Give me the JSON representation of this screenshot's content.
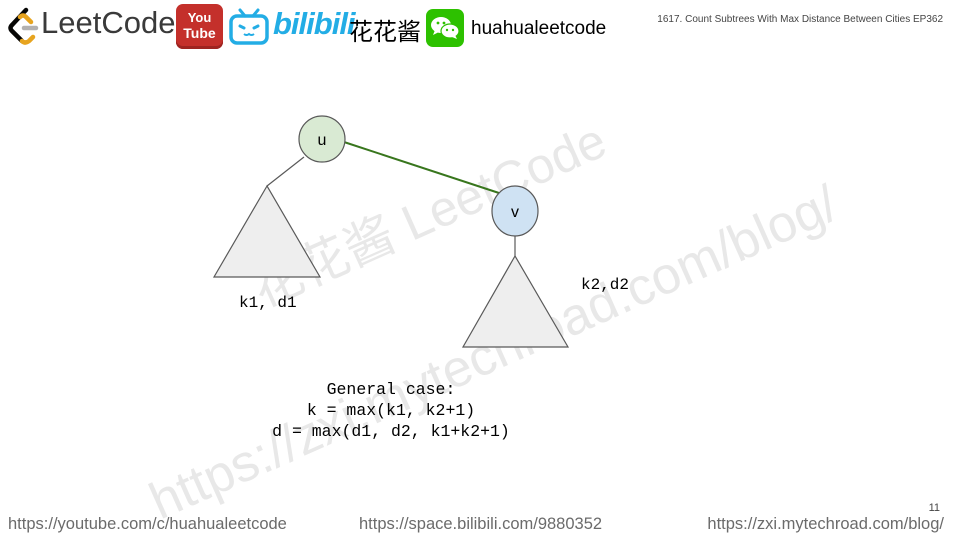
{
  "header": {
    "logo_text": "LeetCode",
    "youtube_text_1": "You",
    "youtube_text_2": "Tube",
    "bilibili_text": "bilibili",
    "channel_cn": "花花酱",
    "wechat_id": "huahualeetcode",
    "episode_title": "1617. Count Subtrees With Max Distance Between Cities EP362"
  },
  "watermark": {
    "line1": "花花酱 LeetCode",
    "line2": "https://zxi.mytechroad.com/blog/"
  },
  "diagram": {
    "node_u": "u",
    "node_v": "v",
    "label_left": "k1, d1",
    "label_right": "k2,d2",
    "colors": {
      "node_u_fill": "#d9ead3",
      "node_v_fill": "#cfe2f3",
      "edge_uv": "#38761d",
      "triangle_fill": "#eeeeee",
      "stroke": "#595959"
    }
  },
  "formula": {
    "line1": "General case:",
    "line2": "k = max(k1, k2+1)",
    "line3": "d = max(d1, d2, k1+k2+1)"
  },
  "footer": {
    "youtube_url": "https://youtube.com/c/huahualeetcode",
    "bilibili_url": "https://space.bilibili.com/9880352",
    "blog_url": "https://zxi.mytechroad.com/blog/",
    "page_number": "11"
  }
}
